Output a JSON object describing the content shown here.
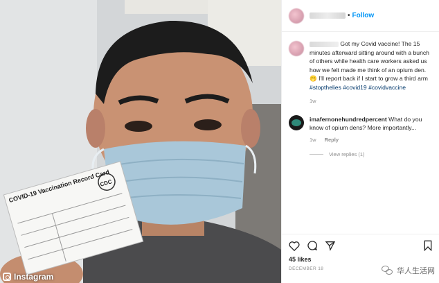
{
  "post": {
    "follow_label": "Follow",
    "caption": {
      "text_before": "Got my Covid vaccine! The 15 minutes afterward sitting around with a bunch of others while health care workers asked us how we felt made me think of an opium den. 🫢 I'll report back if I start to grow a third arm",
      "hashtags": [
        "#stopthelies",
        "#covid19",
        "#covidvaccine"
      ],
      "time": "1w"
    },
    "comments": [
      {
        "username": "imafernonehundredpercent",
        "text": "What do you know of opium dens? More importantly...",
        "time": "1w",
        "reply_label": "Reply",
        "view_replies": "View replies (1)"
      }
    ],
    "likes": "45 likes",
    "date": "DECEMBER 18"
  },
  "icons": {
    "like": "heart-icon",
    "comment": "comment-icon",
    "share": "share-icon",
    "save": "bookmark-icon"
  },
  "photo": {
    "card_title": "COVID-19 Vaccination Record Card",
    "card_logo": "CDC"
  },
  "watermarks": {
    "instagram": "Instagram",
    "wechat": "华人生活网"
  }
}
